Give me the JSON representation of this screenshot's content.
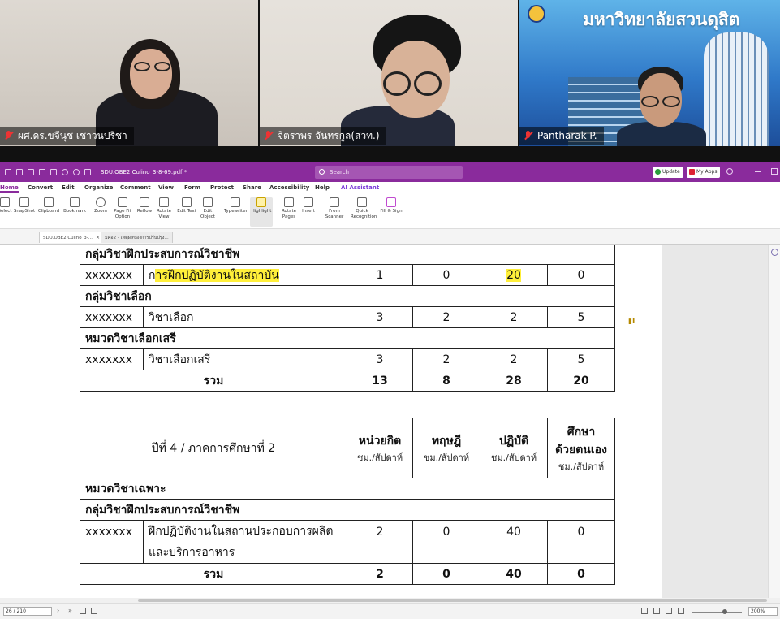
{
  "video": {
    "participants": [
      {
        "name": "ผศ.ดร.ขจีนุช เชาวนปรีชา",
        "muted": true
      },
      {
        "name": "จิตราพร จันทรกูล(สวท.)",
        "muted": true
      },
      {
        "name": "Pantharak P.",
        "muted": true
      }
    ],
    "university_banner": "มหาวิทยาลัยสวนดุสิต"
  },
  "app": {
    "title_filename": "SDU.OBE2.Culino_3-8-69.pdf *",
    "search_placeholder": "Search",
    "update_label": "Update",
    "myapps_label": "My Apps",
    "accent_color": "#8a2b9c",
    "menu": [
      "Home",
      "Convert",
      "Edit",
      "Organize",
      "Comment",
      "View",
      "Form",
      "Protect",
      "Share",
      "Accessibility",
      "Help",
      "AI Assistant"
    ],
    "menu_active": "Home",
    "ribbon": [
      {
        "label": "Select",
        "icon": "cursor-icon"
      },
      {
        "label": "SnapShot",
        "icon": "camera-icon"
      },
      {
        "label": "Clipboard",
        "icon": "clipboard-icon"
      },
      {
        "label": "Bookmark",
        "icon": "bookmark-icon"
      },
      {
        "label": "Zoom",
        "icon": "zoom-icon"
      },
      {
        "label": "Page Fit Option",
        "icon": "page-fit-icon"
      },
      {
        "label": "Reflow",
        "icon": "reflow-icon"
      },
      {
        "label": "Rotate View",
        "icon": "rotate-icon"
      },
      {
        "label": "Edit Text",
        "icon": "edit-text-icon"
      },
      {
        "label": "Edit Object",
        "icon": "edit-object-icon"
      },
      {
        "label": "Typewriter",
        "icon": "typewriter-icon"
      },
      {
        "label": "Highlight",
        "icon": "highlight-icon"
      },
      {
        "label": "Rotate Pages",
        "icon": "rotate-pages-icon"
      },
      {
        "label": "Insert",
        "icon": "insert-icon"
      },
      {
        "label": "From Scanner",
        "icon": "scanner-icon"
      },
      {
        "label": "Quick Recognition",
        "icon": "ocr-icon"
      },
      {
        "label": "Fill & Sign",
        "icon": "pen-icon"
      }
    ],
    "tabs": [
      {
        "label": "SDU.OBE2.Culino_3-...",
        "active": true
      },
      {
        "label": "มคอ2 - เหตุผลของการปรับปรุง...",
        "active": false
      }
    ],
    "status": {
      "page": "26 / 210",
      "zoom": "200%"
    }
  },
  "doc": {
    "table1": {
      "rows": [
        {
          "type": "group",
          "label": "กลุ่มวิชาฝึกประสบการณ์วิชาชีพ"
        },
        {
          "type": "course",
          "code": "xxxxxxx",
          "name_pre": "ก",
          "name_hl": "ารฝึกปฏิบัติงานในสถาบัน",
          "v1": "1",
          "v2": "0",
          "v3": "20",
          "v3_hl": true,
          "v4": "0"
        },
        {
          "type": "group",
          "label": "กลุ่มวิชาเลือก"
        },
        {
          "type": "course",
          "code": "xxxxxxx",
          "name": "วิชาเลือก",
          "v1": "3",
          "v2": "2",
          "v3": "2",
          "v4": "5"
        },
        {
          "type": "group",
          "label": "หมวดวิชาเลือกเสรี"
        },
        {
          "type": "course",
          "code": "xxxxxxx",
          "name": "วิชาเลือกเสรี",
          "v1": "3",
          "v2": "2",
          "v3": "2",
          "v4": "5"
        },
        {
          "type": "sum",
          "label": "รวม",
          "v1": "13",
          "v2": "8",
          "v3": "28",
          "v4": "20"
        }
      ]
    },
    "table2": {
      "title": "ปีที่ 4 / ภาคการศึกษาที่ 2",
      "headers": [
        {
          "top": "หน่วยกิต",
          "sub": "ชม./สัปดาห์"
        },
        {
          "top": "ทฤษฎี",
          "sub": "ชม./สัปดาห์"
        },
        {
          "top": "ปฏิบัติ",
          "sub": "ชม./สัปดาห์"
        },
        {
          "top": "ศึกษาด้วยตนเอง",
          "top1": "ศึกษา",
          "top2": "ด้วยตนเอง",
          "sub": "ชม./สัปดาห์"
        }
      ],
      "group1": "หมวดวิชาเฉพาะ",
      "group2": "กลุ่มวิชาฝึกประสบการณ์วิชาชีพ",
      "course": {
        "code": "xxxxxxx",
        "name1": "ฝึกปฏิบัติงานในสถานประกอบการผลิต",
        "name2": "และบริการอาหาร",
        "v1": "2",
        "v2": "0",
        "v3": "40",
        "v4": "0"
      },
      "sum": {
        "label": "รวม",
        "v1": "2",
        "v2": "0",
        "v3": "40",
        "v4": "0"
      }
    }
  }
}
